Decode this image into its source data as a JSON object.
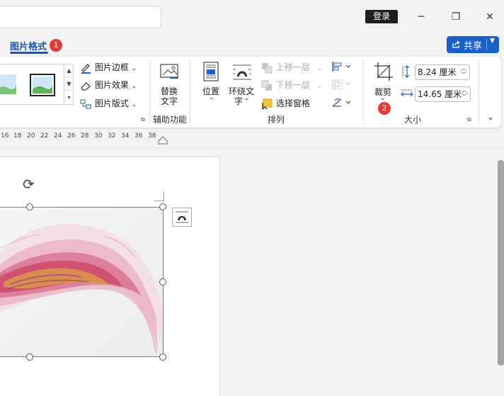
{
  "titlebar": {
    "login_label": "登录",
    "minimize_glyph": "─",
    "restore_glyph": "❐",
    "close_glyph": "✕"
  },
  "tabs": {
    "active_label": "图片格式",
    "badge_1": "1"
  },
  "share": {
    "label": "共享"
  },
  "ribbon": {
    "picture_styles": {
      "border_label": "图片边框",
      "effects_label": "图片效果",
      "layout_label": "图片版式"
    },
    "accessibility": {
      "alt_text_label_line1": "替换",
      "alt_text_label_line2": "文字",
      "group_label": "辅助功能"
    },
    "arrange": {
      "position_label": "位置",
      "wrap_label_line1": "环绕文",
      "wrap_label_line2": "字",
      "bring_forward_label": "上移一层",
      "send_backward_label": "下移一层",
      "selection_pane_label": "选择窗格",
      "group_label": "排列"
    },
    "size": {
      "crop_label": "裁剪",
      "badge_2": "2",
      "height_value": "8.24 厘米",
      "width_value": "14.65 厘米",
      "group_label": "大小"
    }
  },
  "ruler": {
    "ticks": [
      "16",
      "18",
      "20",
      "22",
      "24",
      "26",
      "28",
      "30",
      "32",
      "34",
      "36",
      "38"
    ]
  },
  "colors": {
    "accent": "#1b5fc8",
    "tab_text": "#1a56b8",
    "badge": "#e53935"
  }
}
